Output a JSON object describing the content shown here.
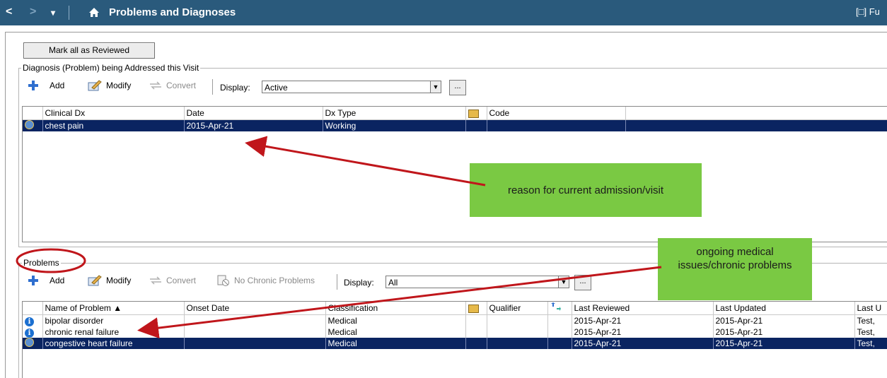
{
  "titlebar": {
    "back": "<",
    "forward": ">",
    "dropdown": "▾",
    "title": "Problems and Diagnoses",
    "full_label": "[□] Fu"
  },
  "mark_reviewed_label": "Mark all as Reviewed",
  "diagnosis": {
    "group_label": "Diagnosis (Problem) being Addressed this Visit",
    "toolbar": {
      "add": "Add",
      "modify": "Modify",
      "convert": "Convert",
      "display_label": "Display:",
      "display_value": "Active",
      "ellipsis": "..."
    },
    "columns": [
      "",
      "Clinical Dx",
      "Date",
      "Dx Type",
      "",
      "Code",
      ""
    ],
    "rows": [
      {
        "clinical_dx": "chest pain",
        "date": "2015-Apr-21",
        "dx_type": "Working",
        "code": ""
      }
    ]
  },
  "problems": {
    "group_label": "Problems",
    "toolbar": {
      "add": "Add",
      "modify": "Modify",
      "convert": "Convert",
      "no_chronic": "No Chronic Problems",
      "display_label": "Display:",
      "display_value": "All",
      "ellipsis": "..."
    },
    "columns": [
      "",
      "Name of Problem ▲",
      "Onset Date",
      "Classification",
      "",
      "Qualifier",
      "",
      "Last Reviewed",
      "Last Updated",
      "Last U"
    ],
    "rows": [
      {
        "name": "bipolar disorder",
        "onset": "",
        "classification": "Medical",
        "qualifier": "",
        "last_reviewed": "2015-Apr-21",
        "last_updated": "2015-Apr-21",
        "last_by": "Test,"
      },
      {
        "name": "chronic renal failure",
        "onset": "",
        "classification": "Medical",
        "qualifier": "",
        "last_reviewed": "2015-Apr-21",
        "last_updated": "2015-Apr-21",
        "last_by": "Test,"
      },
      {
        "name": "congestive heart failure",
        "onset": "",
        "classification": "Medical",
        "qualifier": "",
        "last_reviewed": "2015-Apr-21",
        "last_updated": "2015-Apr-21",
        "last_by": "Test,"
      }
    ]
  },
  "annotations": {
    "callout1": "reason for current admission/visit",
    "callout2": "ongoing medical issues/chronic problems",
    "arrow_color": "#c0161b",
    "callout_color": "#7ac943"
  },
  "colors": {
    "titlebar": "#2a5a7c",
    "selected_row": "#0a2461"
  }
}
